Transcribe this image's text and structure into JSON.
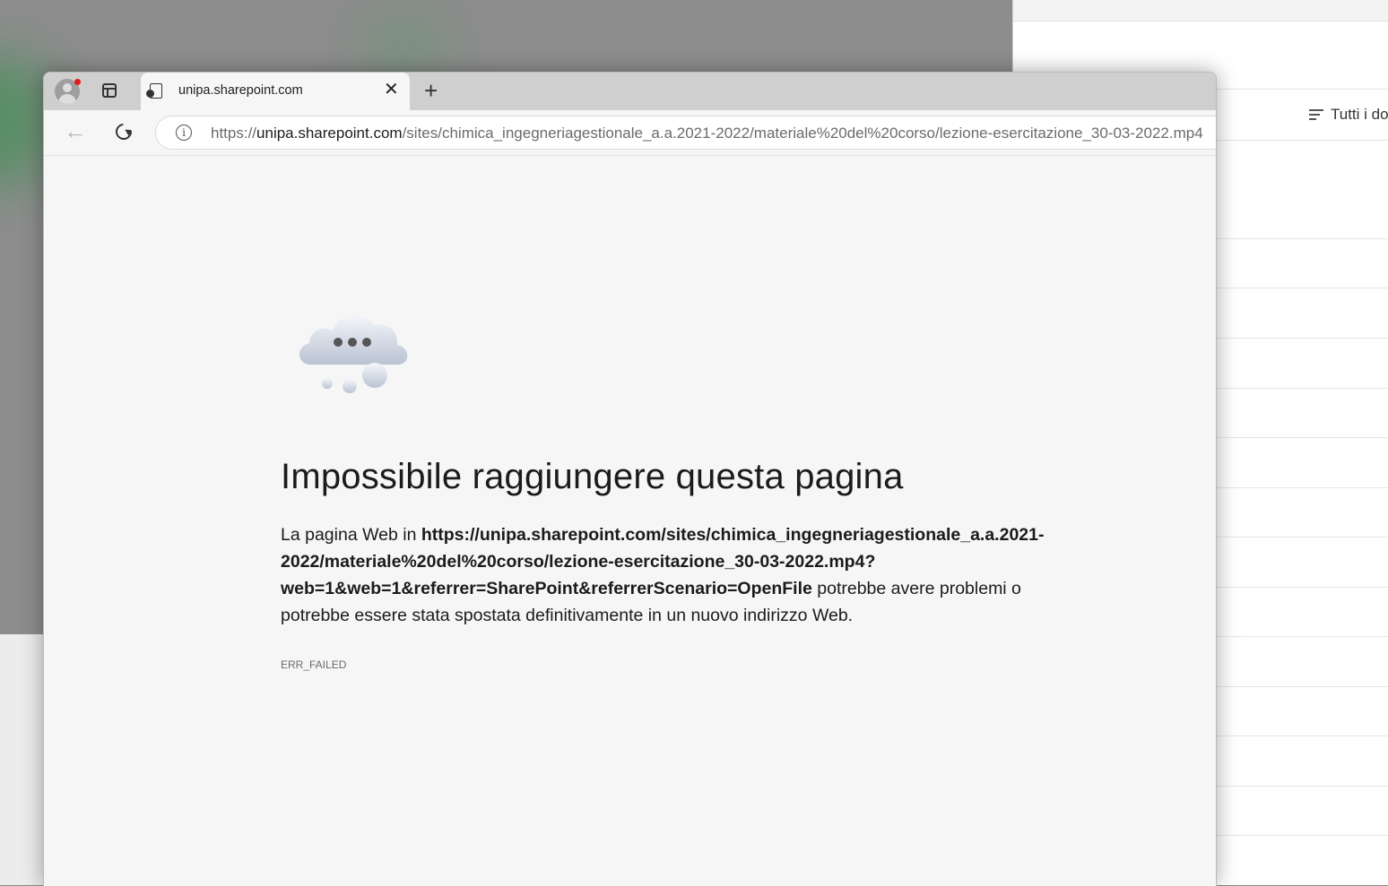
{
  "browser": {
    "tab": {
      "title": "unipa.sharepoint.com",
      "close_symbol": "✕"
    },
    "new_tab_symbol": "+",
    "back_symbol": "←",
    "address_bar": {
      "info_symbol": "i",
      "url_prefix": "https://",
      "url_host": "unipa.sharepoint.com",
      "url_path": "/sites/chimica_ingegneriagestionale_a.a.2021-2022/materiale%20del%20corso/lezione-esercitazione_30-03-2022.mp4"
    },
    "icons": {
      "profile": "profile-avatar-icon",
      "notification": "notification-dot-icon",
      "tab_actions": "vertical-tabs-icon",
      "tab_favicon": "file-error-icon",
      "back": "back-arrow-icon",
      "reload": "reload-icon",
      "info": "info-icon",
      "illustration": "cloud-thinking-icon"
    }
  },
  "error_page": {
    "title": "Impossibile raggiungere questa pagina",
    "body_prefix": "La pagina Web in ",
    "body_url": "https://unipa.sharepoint.com/sites/chimica_ingegneriagestionale_a.a.2021-2022/materiale%20del%20corso/lezione-esercitazione_30-03-2022.mp4?web=1&web=1&referrer=SharePoint&referrerScenario=OpenFile",
    "body_suffix": " potrebbe avere problemi o potrebbe essere stata spostata definitivamente in un nuovo indirizzo Web.",
    "error_code": "ERR_FAILED"
  },
  "background_window": {
    "filter_label": "Tutti i do",
    "icon": "filter-lines-icon"
  },
  "colors": {
    "tabstrip": "#cfcfcf",
    "page_background": "#f6f6f6",
    "notification_dot": "#e01b1b"
  }
}
